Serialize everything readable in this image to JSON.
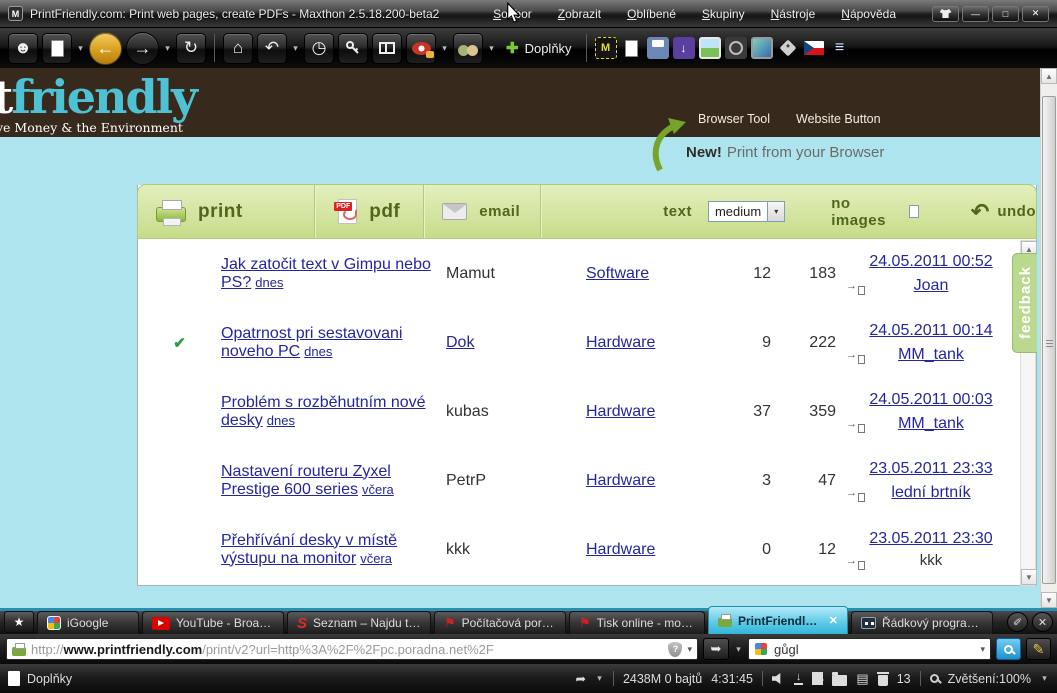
{
  "colors": {
    "accent_teal": "#4fc1d4",
    "header_brown": "#37291c",
    "band_blue": "#aee4ee",
    "actionbar_green": "#c6dc8a",
    "link_navy": "#23279e",
    "active_tab_cyan": "#62cbe6",
    "feedback_green": "#b9d98e",
    "back_button_gold": "#d99e1e"
  },
  "icons": {
    "maxthon_logo": "M",
    "user": "☻",
    "back": "←",
    "forward": "→",
    "caret": "▾",
    "refresh": "↻",
    "home": "⌂",
    "undo": "↶",
    "history": "◷",
    "addons_plus": "✚",
    "list": "≡",
    "bat": "M",
    "download_arrow": "↓",
    "star": "★",
    "tab_close": "✕",
    "tab_pen": "✐",
    "flag": "⚑",
    "seznam_s": "S",
    "minimize": "—",
    "maximize": "□",
    "close": "✕",
    "go": "➥",
    "pencil": "✎",
    "shield_q": "?",
    "clipboard": "▤",
    "jump": "➦",
    "check": "✔",
    "goto_arrow": "→"
  },
  "titlebar": {
    "title": "PrintFriendly.com: Print web pages, create PDFs - Maxthon 2.5.18.200-beta2",
    "menus": [
      "Soubor",
      "Zobrazit",
      "Oblíbené",
      "Skupiny",
      "Nástroje",
      "Nápověda"
    ]
  },
  "main_toolbar": {
    "addons_label": "Doplňky"
  },
  "pf_header": {
    "logo_white": "t",
    "logo_teal": "friendly",
    "tagline": "ve Money & the Environment",
    "nav": [
      "Browser Tool",
      "Website Button"
    ],
    "new_badge": "New!",
    "new_text": "Print from your Browser"
  },
  "pf_toolbar": {
    "print_label": "print",
    "pdf_label": "pdf",
    "email_label": "email",
    "text_label": "text",
    "text_size_value": "medium",
    "no_images_label": "no images",
    "undo_label": "undo"
  },
  "feedback_label": "feedback",
  "forum_table": {
    "rows": [
      {
        "title": "Jak zatočit text v Gimpu nebo PS?",
        "when": "dnes",
        "author": "Mamut",
        "category": "Software",
        "replies": "12",
        "views": "183",
        "datetime": "24.05.2011 00:52",
        "last_user": "Joan"
      },
      {
        "check": "✔",
        "title": "Opatrnost pri sestavovani noveho PC",
        "when": "dnes",
        "author": "Dok",
        "category": "Hardware",
        "replies": "9",
        "views": "222",
        "datetime": "24.05.2011 00:14",
        "last_user": "MM_tank"
      },
      {
        "title": "Problém s rozběhutním nové desky",
        "when": "dnes",
        "author": "kubas",
        "category": "Hardware",
        "replies": "37",
        "views": "359",
        "datetime": "24.05.2011 00:03",
        "last_user": "MM_tank"
      },
      {
        "title": "Nastavení routeru Zyxel Prestige 600 series",
        "when": "včera",
        "author": "PetrP",
        "category": "Hardware",
        "replies": "3",
        "views": "47",
        "datetime": "23.05.2011 23:33",
        "last_user": "lední brtník"
      },
      {
        "title": "Přehřívání desky v místě výstupu na monitor",
        "when": "včera",
        "author": "kkk",
        "category": "Hardware",
        "replies": "0",
        "views": "12",
        "datetime": "23.05.2011 23:30",
        "last_user": "kkk"
      }
    ]
  },
  "tabbar": {
    "tabs": [
      {
        "label": "iGoogle"
      },
      {
        "label": "YouTube - Broadc..."
      },
      {
        "label": "Seznam – Najdu ta..."
      },
      {
        "label": "Počítačová poradn..."
      },
      {
        "label": "Tisk online - možn..."
      },
      {
        "label": "PrintFriendly.c..."
      },
      {
        "label": "Řádkový program ..."
      }
    ]
  },
  "addressbar": {
    "url_protocol": "http://",
    "url_domain": "www.printfriendly.com",
    "url_path": "/print/v2?url=http%3A%2F%2Fpc.poradna.net%2F",
    "search_value": "gůgl"
  },
  "statusbar": {
    "left_label": "Doplňky",
    "traffic": "2438M 0 bajtů",
    "time": "4:31:45",
    "trash_count": "13",
    "zoom_label": "Zvětšení:100%"
  }
}
